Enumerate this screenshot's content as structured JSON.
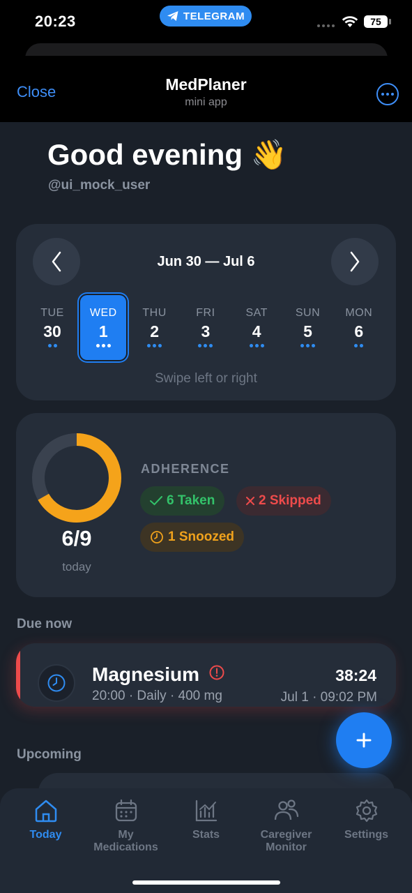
{
  "status_bar": {
    "time": "20:23",
    "pill_label": "TELEGRAM",
    "battery": "75"
  },
  "header": {
    "close_label": "Close",
    "title": "MedPlaner",
    "subtitle": "mini app",
    "more_icon": "ellipsis-circle-icon"
  },
  "greeting": {
    "title": "Good evening 👋",
    "username": "@ui_mock_user"
  },
  "week": {
    "range": "Jun 30 — Jul 6",
    "hint": "Swipe left or right",
    "days": [
      {
        "name": "TUE",
        "num": "30",
        "dots": 2
      },
      {
        "name": "WED",
        "num": "1",
        "dots": 3,
        "selected": true
      },
      {
        "name": "THU",
        "num": "2",
        "dots": 3
      },
      {
        "name": "FRI",
        "num": "3",
        "dots": 3
      },
      {
        "name": "SAT",
        "num": "4",
        "dots": 3
      },
      {
        "name": "SUN",
        "num": "5",
        "dots": 3
      },
      {
        "name": "MON",
        "num": "6",
        "dots": 2
      }
    ]
  },
  "adherence": {
    "label": "ADHERENCE",
    "value": "6/9",
    "sub": "today",
    "progress": 0.667,
    "taken": "6 Taken",
    "skipped": "2 Skipped",
    "snoozed": "1 Snoozed",
    "colors": {
      "ring": "#f5a31a",
      "track": "#3a424f",
      "taken": "#33c26a",
      "skipped": "#ee4b4b",
      "snoozed": "#f0a21c"
    }
  },
  "due_now": {
    "label": "Due now",
    "med_name": "Magnesium",
    "meta": "20:00 · Daily · 400 mg",
    "countdown": "38:24",
    "time": "Jul 1 · 09:02 PM"
  },
  "upcoming": {
    "label": "Upcoming"
  },
  "tabs": [
    {
      "label": "Today",
      "icon": "home-icon",
      "active": true
    },
    {
      "label": "My Medications",
      "icon": "calendar-icon"
    },
    {
      "label": "Stats",
      "icon": "chart-icon"
    },
    {
      "label": "Caregiver Monitor",
      "icon": "people-icon"
    },
    {
      "label": "Settings",
      "icon": "gear-icon"
    }
  ],
  "accent_color": "#1f7ef2"
}
